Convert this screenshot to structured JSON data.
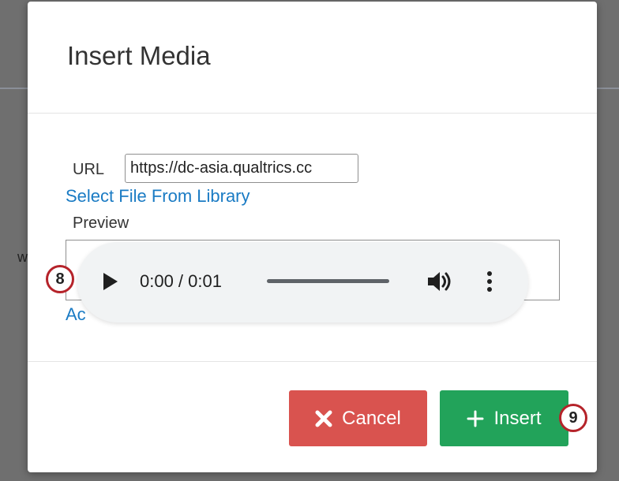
{
  "dialog": {
    "title": "Insert Media",
    "url_label": "URL",
    "url_value": "https://dc-asia.qualtrics.cc",
    "select_file_link": "Select File From Library",
    "preview_label": "Preview",
    "add_link_partial": "Ac"
  },
  "audio_player": {
    "time_display": "0:00 / 0:01",
    "progress_fraction": 0,
    "icons": [
      "play-icon",
      "volume-icon",
      "more-options-icon"
    ]
  },
  "buttons": {
    "cancel_label": "Cancel",
    "insert_label": "Insert",
    "cancel_icon": "close-x-icon",
    "insert_icon": "plus-icon"
  },
  "callouts": {
    "step_8": "8",
    "step_9": "9"
  },
  "background": {
    "partial_text": "w"
  },
  "colors": {
    "cancel": "#d9534f",
    "insert": "#22a35a",
    "link": "#1a7bc4",
    "callout_ring": "#b5232a",
    "player_bg": "#f1f3f4"
  }
}
